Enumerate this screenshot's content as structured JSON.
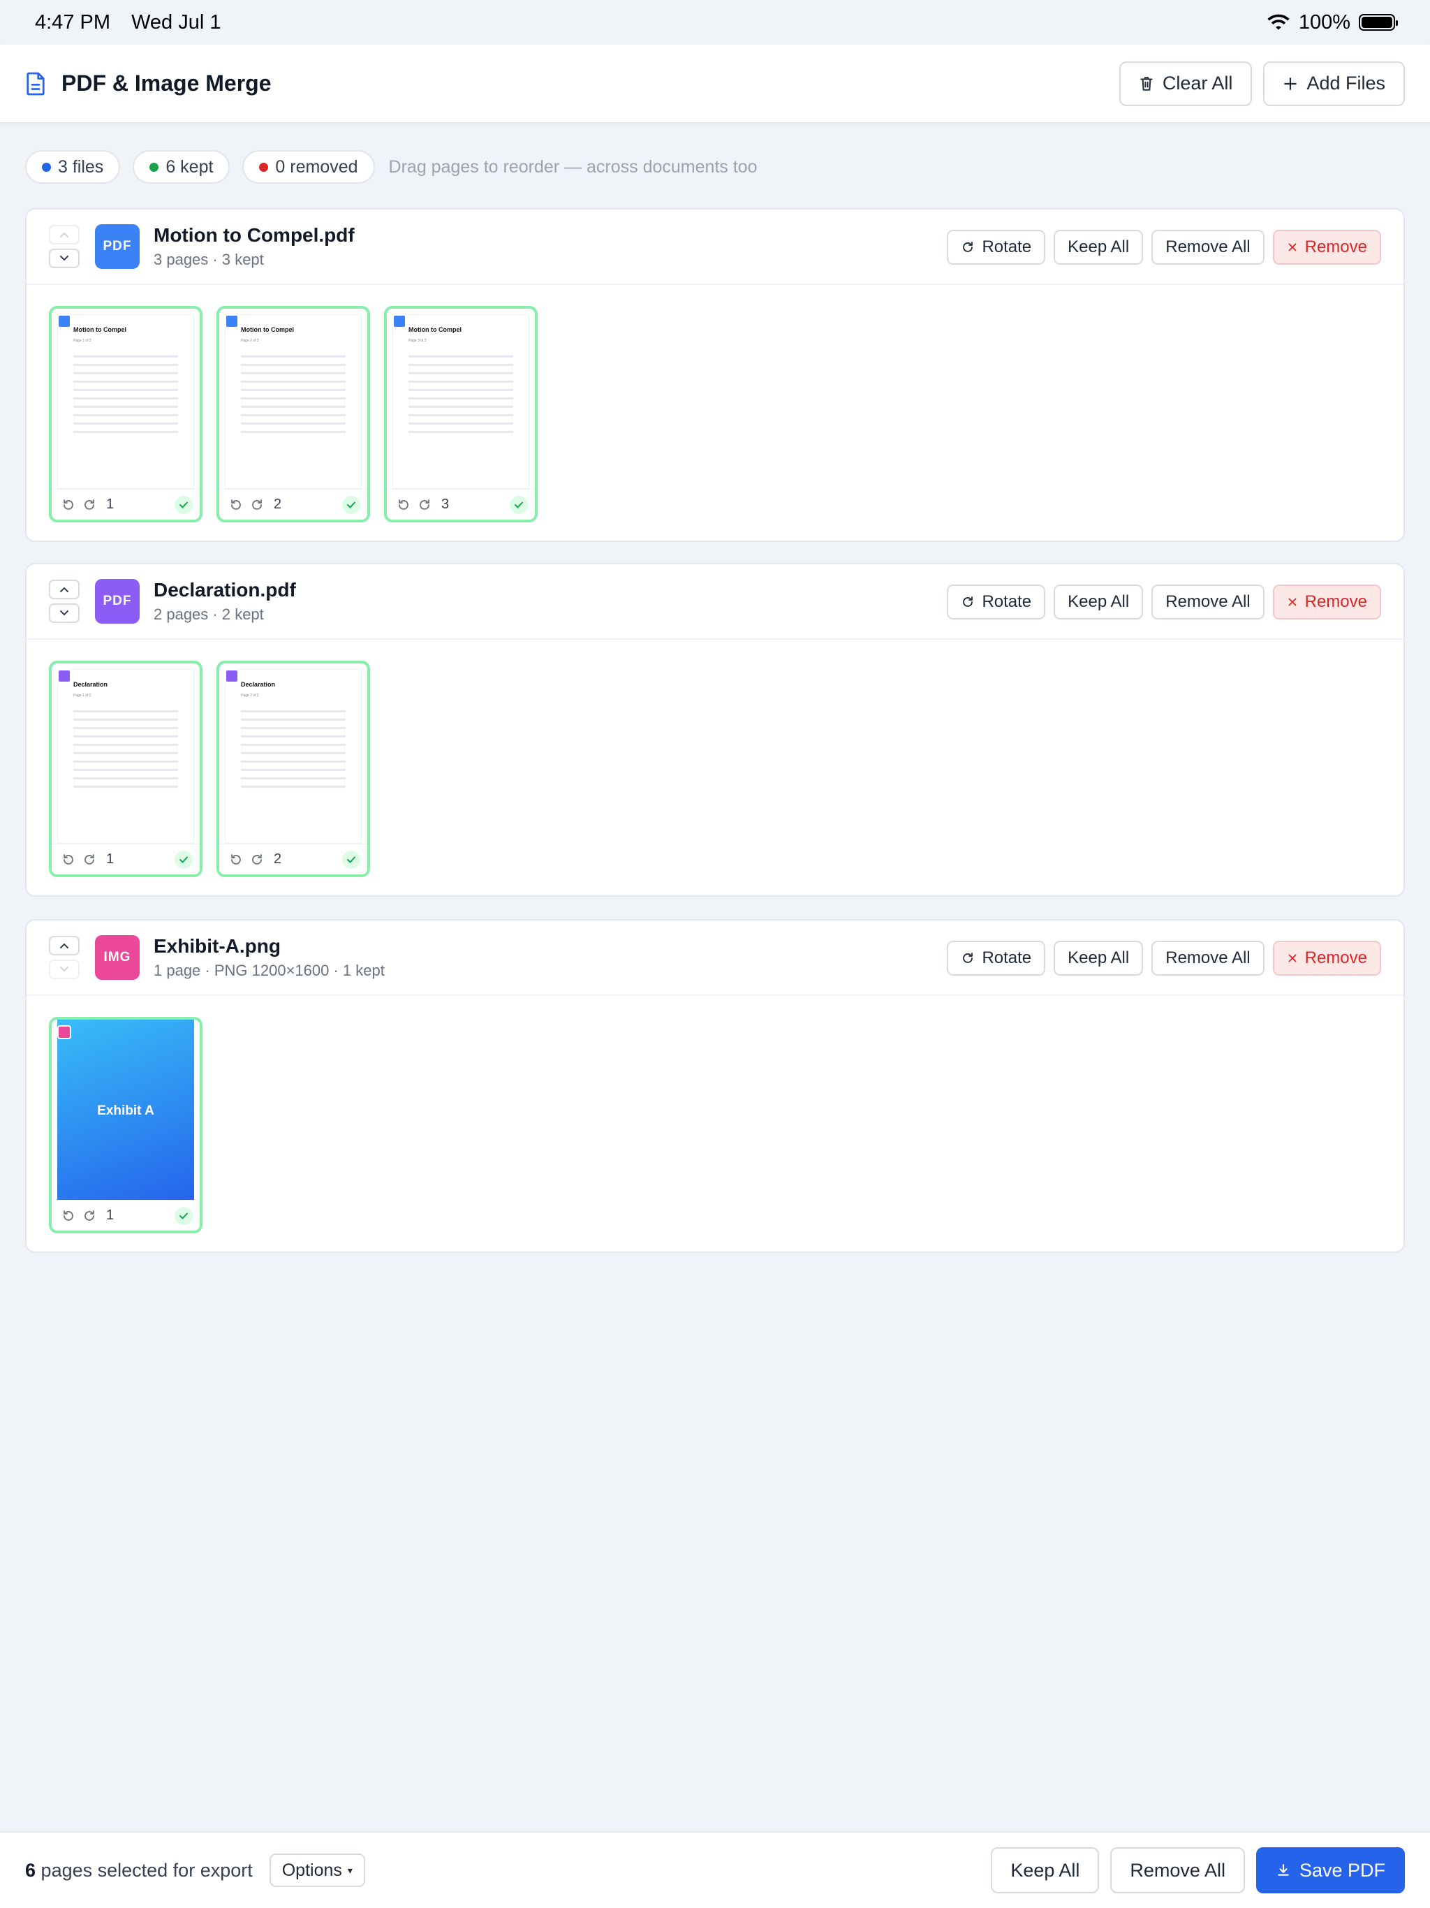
{
  "status_bar": {
    "time": "4:47 PM",
    "date": "Wed Jul 1",
    "battery": "100%"
  },
  "header": {
    "title": "PDF & Image Merge",
    "clear_label": "Clear All",
    "add_label": "Add Files"
  },
  "stats": {
    "files": "3 files",
    "kept": "6 kept",
    "removed": "0 removed",
    "hint": "Drag pages to reorder — across documents too"
  },
  "colors": {
    "accent": "#2563eb",
    "files_dot": "#2563eb",
    "kept_dot": "#16a34a",
    "removed_dot": "#dc2626",
    "doc1": "#3b82f6",
    "doc2": "#8b5cf6",
    "doc3": "#ec4899"
  },
  "card_actions": {
    "rotate": "Rotate",
    "keep_all": "Keep All",
    "remove_all": "Remove All",
    "remove": "Remove"
  },
  "documents": [
    {
      "badge": "PDF",
      "name": "Motion to Compel.pdf",
      "meta": "3 pages · 3 kept",
      "doc_title": "Motion to Compel",
      "page_subtitles": [
        "Page 1 of 3",
        "Page 2 of 3",
        "Page 3 of 3"
      ],
      "pages": [
        "1",
        "2",
        "3"
      ]
    },
    {
      "badge": "PDF",
      "name": "Declaration.pdf",
      "meta": "2 pages · 2 kept",
      "doc_title": "Declaration",
      "page_subtitles": [
        "Page 1 of 2",
        "Page 2 of 2"
      ],
      "pages": [
        "1",
        "2"
      ]
    },
    {
      "badge": "IMG",
      "name": "Exhibit-A.png",
      "meta": "1 page · PNG 1200×1600 · 1 kept",
      "image_text": "Exhibit A",
      "pages": [
        "1"
      ]
    }
  ],
  "footer": {
    "count": "6",
    "count_suffix": "pages selected for export",
    "options": "Options",
    "keep_all": "Keep All",
    "remove_all": "Remove All",
    "save": "Save PDF"
  }
}
